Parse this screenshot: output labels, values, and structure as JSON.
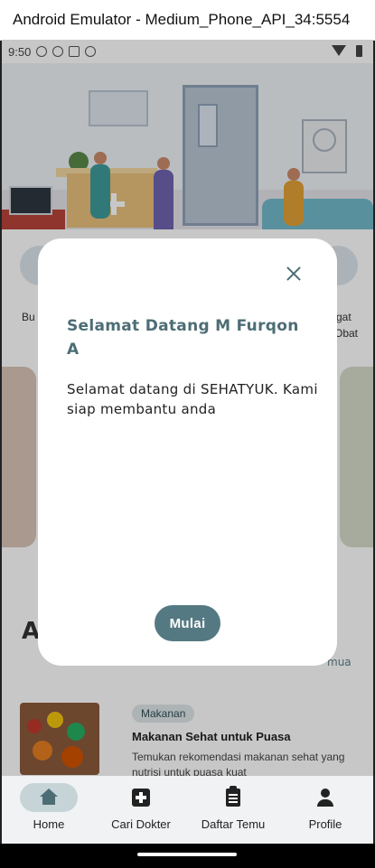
{
  "window": {
    "title": "Android Emulator - Medium_Phone_API_34:5554"
  },
  "status_bar": {
    "time": "9:50"
  },
  "background": {
    "categories": [
      {
        "label": "Bu"
      },
      {
        "label": "gat"
      },
      {
        "label": "Obat"
      }
    ],
    "section_heading": "A",
    "section_link": "mua",
    "article": {
      "tag": "Makanan",
      "title": "Makanan Sehat untuk Puasa",
      "description": "Temukan rekomendasi makanan sehat yang nutrisi untuk puasa kuat"
    }
  },
  "dialog": {
    "title": "Selamat Datang M Furqon A",
    "message": "Selamat datang di SEHATYUK. Kami siap membantu anda",
    "button_label": "Mulai",
    "close_icon": "close-icon"
  },
  "bottom_nav": {
    "items": [
      {
        "label": "Home",
        "icon": "home-icon",
        "active": true
      },
      {
        "label": "Cari Dokter",
        "icon": "medical-box-icon",
        "active": false
      },
      {
        "label": "Daftar Temu",
        "icon": "clipboard-icon",
        "active": false
      },
      {
        "label": "Profile",
        "icon": "person-icon",
        "active": false
      }
    ]
  },
  "colors": {
    "accent": "#557982",
    "title": "#4d6d75",
    "nav_active": "#c6d4d8"
  }
}
